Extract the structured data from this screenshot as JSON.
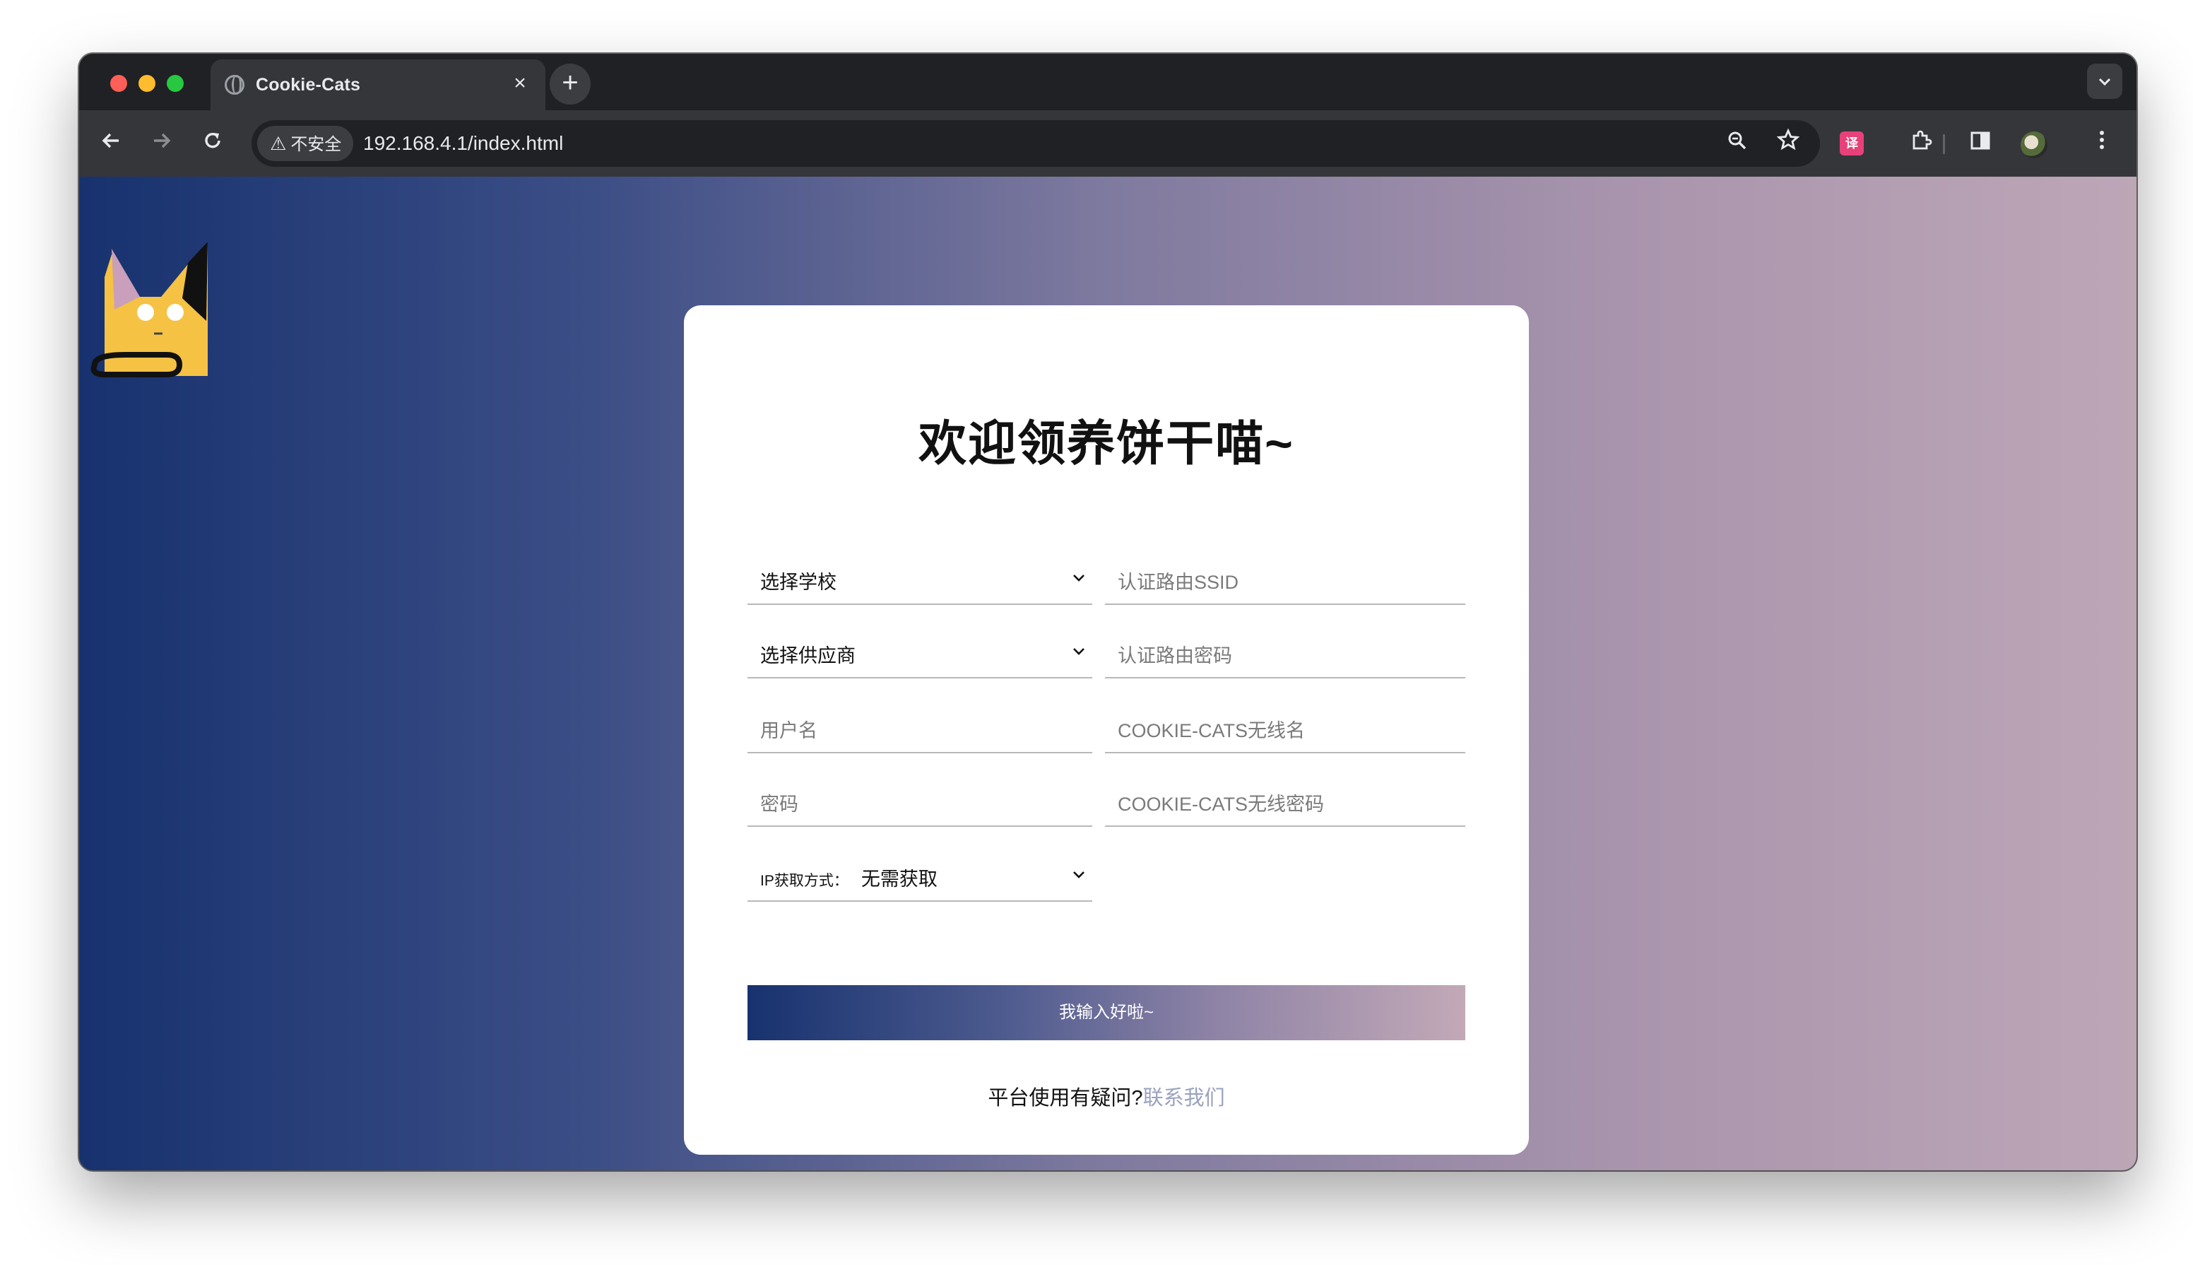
{
  "browser": {
    "tab_title": "Cookie-Cats",
    "tab_close": "×",
    "new_tab": "+",
    "security_chip": "不安全",
    "url": "192.168.4.1/index.html",
    "ext_badge": "译"
  },
  "page": {
    "heading": "欢迎领养饼干喵~",
    "fields": {
      "school_select": "选择学校",
      "router_ssid_placeholder": "认证路由SSID",
      "provider_select": "选择供应商",
      "router_password_placeholder": "认证路由密码",
      "username_placeholder": "用户名",
      "wifi_name_placeholder": "COOKIE-CATS无线名",
      "password_placeholder": "密码",
      "wifi_password_placeholder": "COOKIE-CATS无线密码",
      "ip_mode_label": "IP获取方式：",
      "ip_mode_value": "无需获取"
    },
    "submit_label": "我输入好啦~",
    "help_text": "平台使用有疑问?",
    "help_link": "联系我们"
  },
  "colors": {
    "gradient_start": "#17326f",
    "gradient_end": "#bda6b6",
    "link": "#9aa2bf"
  }
}
